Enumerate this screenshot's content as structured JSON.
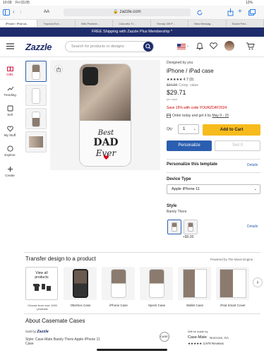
{
  "status": {
    "time": "10:09",
    "date": "Fri 03.05",
    "battery": "12%"
  },
  "browser": {
    "aa": "AA",
    "url": "zazzle.com"
  },
  "tabs": [
    "iPhone / iPad ca...",
    "Tropical Eve...",
    "Wild Parente...",
    "Colourful Tr...",
    "Trendy Gift P...",
    "New Messag...",
    "Social Part..."
  ],
  "promo": {
    "text": "FREE Shipping with Zazzle Plus Membership *"
  },
  "header": {
    "logo": "Zazzle",
    "search_placeholder": "Search for products or designs"
  },
  "sidenav": [
    {
      "label": "Gifts",
      "icon": "gift-icon"
    },
    {
      "label": "Trending",
      "icon": "trending-icon"
    },
    {
      "label": "Sell",
      "icon": "sell-icon"
    },
    {
      "label": "My Stuff",
      "icon": "heart-icon"
    },
    {
      "label": "Explore",
      "icon": "explore-icon"
    },
    {
      "label": "Create",
      "icon": "create-icon"
    }
  ],
  "artwork": {
    "line1": "Best",
    "line2": "DAD",
    "line3": "Ever"
  },
  "product": {
    "designed_by": "Designed by you",
    "title": "iPhone / iPad case",
    "rating": "★★★★★ 4.7 (0)",
    "old_price": "$34.99",
    "comp": "Comp. value",
    "price": "$29.71",
    "per": "per case",
    "promo": "Save 15% with code YOURZDAY2024",
    "delivery_prefix": "Order today and get it by",
    "delivery_date": "May 9 - 15",
    "qty_label": "Qty:",
    "qty": "1",
    "add_to_cart": "Add to Cart",
    "personalize": "Personalize",
    "sell_it": "Sell It"
  },
  "personalize_template": {
    "title": "Personalize this template",
    "details": "Details"
  },
  "device_type": {
    "title": "Device Type",
    "value": "Apple iPhone 11"
  },
  "style": {
    "title": "Style",
    "value": "Barely There",
    "extra_price": "+$5.00",
    "details": "Details"
  },
  "transfer": {
    "title": "Transfer design to a product",
    "powered": "Powered by The Move Engine",
    "view_all": "View all products",
    "choose": "Choose from over 1000 products",
    "items": [
      "Otterbox Case",
      "iPhone Case",
      "Speck Case",
      "Wallet Case",
      "iPad Smart Cover"
    ]
  },
  "about": {
    "title": "About Casemate Cases",
    "sold_by_label": "Sold by",
    "sold_by": "Zazzle",
    "style_line": "Style: Case-Mate Barely There Apple iPhone 11 Case",
    "made_by_label": "Will be made by",
    "maker": "Case-Mate",
    "location": "Norcross, GA",
    "reviews": "★★★★★ 3,979 Reviews",
    "cm_logo": "CASE-MATE"
  }
}
